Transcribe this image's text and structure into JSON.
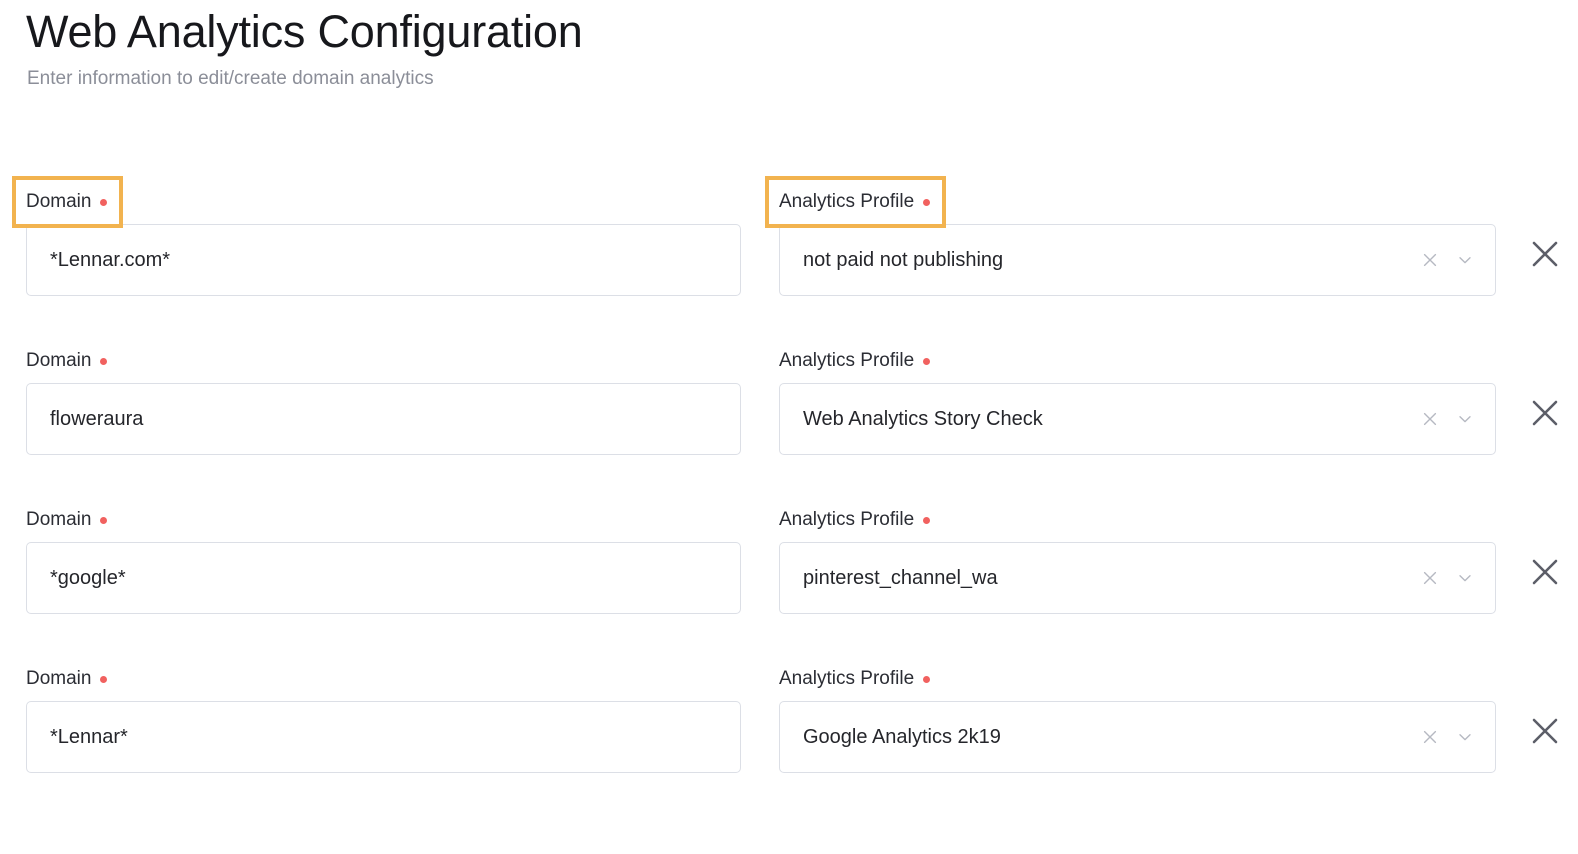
{
  "header": {
    "title": "Web Analytics Configuration",
    "subtitle": "Enter information to edit/create domain analytics"
  },
  "colors": {
    "highlight_ring": "#f2b34f",
    "required_dot": "#f1615f",
    "field_border": "#dcdfe6",
    "value_text": "#25262b",
    "subtitle_text": "#8b8e98"
  },
  "labels": {
    "domain": "Domain",
    "analytics_profile": "Analytics Profile"
  },
  "icons": {
    "clear": "clear-icon",
    "chevron": "chevron-down-icon",
    "remove": "remove-row-icon"
  },
  "rows": [
    {
      "domain": {
        "label": "Domain",
        "value": "*Lennar.com*",
        "placeholder": "",
        "highlighted": true
      },
      "profile": {
        "label": "Analytics Profile",
        "value": "not paid not publishing",
        "placeholder": "",
        "highlighted": true
      }
    },
    {
      "domain": {
        "label": "Domain",
        "value": "floweraura",
        "placeholder": "",
        "highlighted": false
      },
      "profile": {
        "label": "Analytics Profile",
        "value": "Web Analytics Story Check",
        "placeholder": "",
        "highlighted": false
      }
    },
    {
      "domain": {
        "label": "Domain",
        "value": "*google*",
        "placeholder": "",
        "highlighted": false
      },
      "profile": {
        "label": "Analytics Profile",
        "value": "pinterest_channel_wa",
        "placeholder": "",
        "highlighted": false
      }
    },
    {
      "domain": {
        "label": "Domain",
        "value": "*Lennar*",
        "placeholder": "",
        "highlighted": false
      },
      "profile": {
        "label": "Analytics Profile",
        "value": "Google Analytics 2k19",
        "placeholder": "",
        "highlighted": false
      }
    }
  ]
}
